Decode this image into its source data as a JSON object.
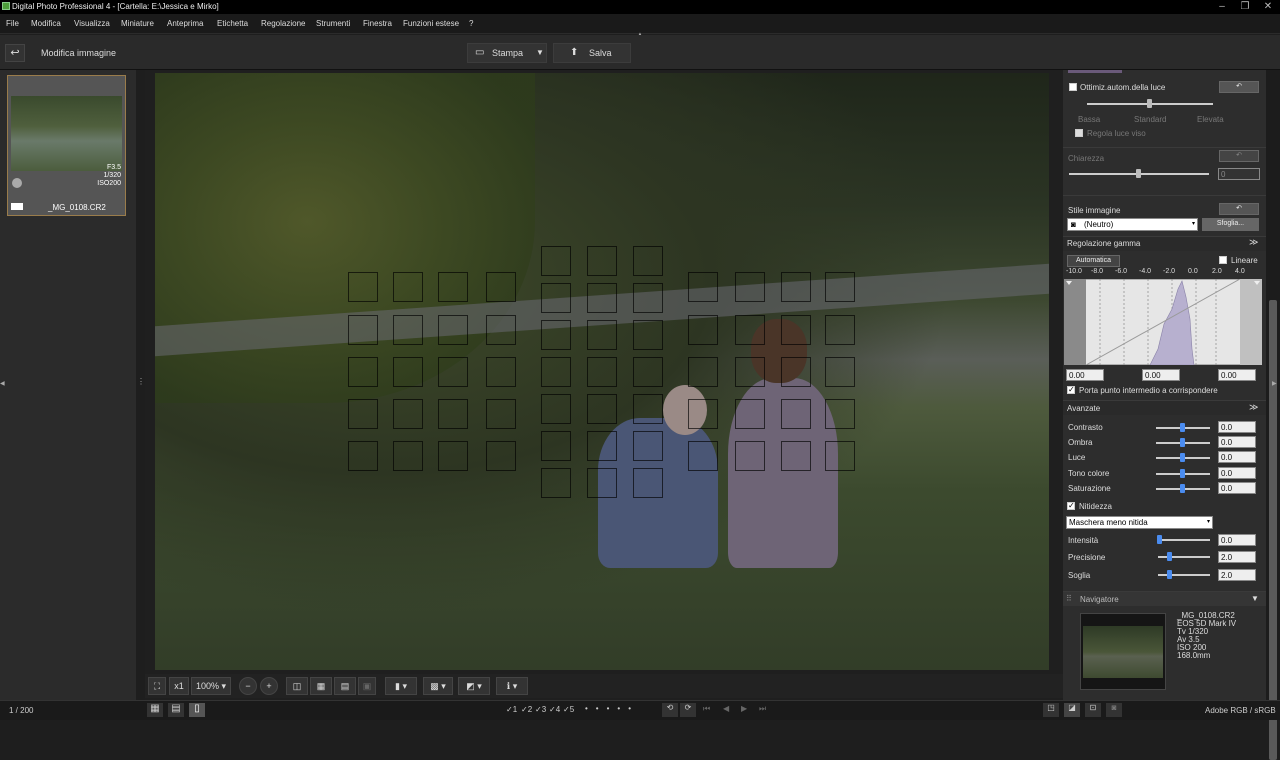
{
  "window": {
    "title": "Digital Photo Professional 4 - [Cartella: E:\\Jessica e Mirko]"
  },
  "menu": [
    "File",
    "Modifica",
    "Visualizza",
    "Miniature",
    "Anteprima",
    "Etichetta",
    "Regolazione",
    "Strumenti",
    "Finestra",
    "Funzioni estese",
    "?"
  ],
  "toolbar": {
    "back_label": "Modifica immagine",
    "print_label": "Stampa",
    "save_label": "Salva"
  },
  "thumbnail": {
    "aperture": "F3.5",
    "shutter": "1/320",
    "iso": "ISO200",
    "filename": "_MG_0108.CR2"
  },
  "viewer": {
    "zoom_x1": "x1",
    "zoom": "100%"
  },
  "status": {
    "page": "1 / 200",
    "color_space": "Adobe RGB / sRGB",
    "ratings": [
      "1",
      "2",
      "3",
      "4",
      "5"
    ]
  },
  "panel": {
    "alo": {
      "label": "Ottimiz.autom.della luce",
      "levels": [
        "Bassa",
        "Standard",
        "Elevata"
      ],
      "faces": "Regola luce viso"
    },
    "clarity": {
      "label": "Chiarezza",
      "value": "0"
    },
    "style": {
      "label": "Stile immagine",
      "value": "(Neutro)",
      "browse": "Sfoglia..."
    },
    "gamma": {
      "label": "Regolazione gamma",
      "auto": "Automatica",
      "linear": "Lineare",
      "scale": [
        "-10.0",
        "-8.0",
        "-6.0",
        "-4.0",
        "-2.0",
        "0.0",
        "2.0",
        "4.0"
      ],
      "left_val": "0.00",
      "mid_val": "0.00",
      "right_val": "0.00",
      "link": "Porta punto intermedio a corrispondere"
    },
    "advanced": {
      "label": "Avanzate",
      "rows": [
        {
          "label": "Contrasto",
          "value": "0.0"
        },
        {
          "label": "Ombra",
          "value": "0.0"
        },
        {
          "label": "Luce",
          "value": "0.0"
        },
        {
          "label": "Tono colore",
          "value": "0.0"
        },
        {
          "label": "Saturazione",
          "value": "0.0"
        }
      ]
    },
    "sharpness": {
      "label": "Nitidezza",
      "mode": "Maschera meno nitida",
      "rows": [
        {
          "label": "Intensità",
          "value": "0.0"
        },
        {
          "label": "Precisione",
          "value": "2.0"
        },
        {
          "label": "Soglia",
          "value": "2.0"
        }
      ]
    },
    "navigator": {
      "label": "Navigatore",
      "info": [
        "_MG_0108.CR2",
        "EOS 5D Mark IV",
        "Tv 1/320",
        "Av 3.5",
        "ISO 200",
        "168.0mm"
      ]
    }
  },
  "colors": {
    "accent": "#4a8cf0",
    "thumb_border": "#9a7c4b"
  }
}
